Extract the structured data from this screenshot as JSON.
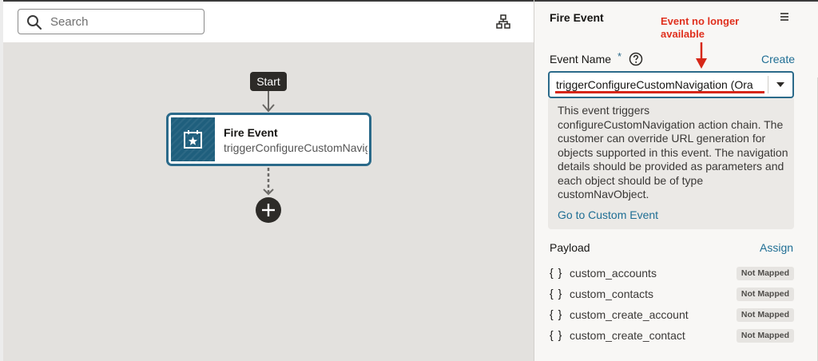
{
  "search": {
    "placeholder": "Search"
  },
  "canvas": {
    "start_label": "Start",
    "node": {
      "title": "Fire Event",
      "subtitle": "triggerConfigureCustomNavigation"
    }
  },
  "panel": {
    "title": "Fire Event",
    "annotation": "Event no longer available",
    "event_name": {
      "label": "Event Name",
      "required_marker": "*",
      "create_label": "Create",
      "selected_value": "triggerConfigureCustomNavigation (Ora",
      "description": "This event triggers configureCustomNavigation action chain. The customer can override URL generation for objects supported in this event. The navigation details should be provided as parameters and each object should be of type customNavObject.",
      "go_to_label": "Go to Custom Event"
    },
    "payload": {
      "label": "Payload",
      "assign_label": "Assign",
      "items": [
        {
          "icon": "{ }",
          "name": "custom_accounts",
          "status": "Not Mapped"
        },
        {
          "icon": "{ }",
          "name": "custom_contacts",
          "status": "Not Mapped"
        },
        {
          "icon": "{ }",
          "name": "custom_create_account",
          "status": "Not Mapped"
        },
        {
          "icon": "{ }",
          "name": "custom_create_contact",
          "status": "Not Mapped"
        }
      ]
    }
  },
  "colors": {
    "accent": "#2b6a8a",
    "link": "#1f6e94",
    "annotation": "#e0301e",
    "canvas_bg": "#e3e1de"
  },
  "icons": [
    "search-icon",
    "diagram-tree-icon",
    "hamburger-menu-icon",
    "help-icon",
    "chevron-down-icon",
    "event-calendar-icon",
    "plus-icon",
    "arrow-down-icon"
  ]
}
